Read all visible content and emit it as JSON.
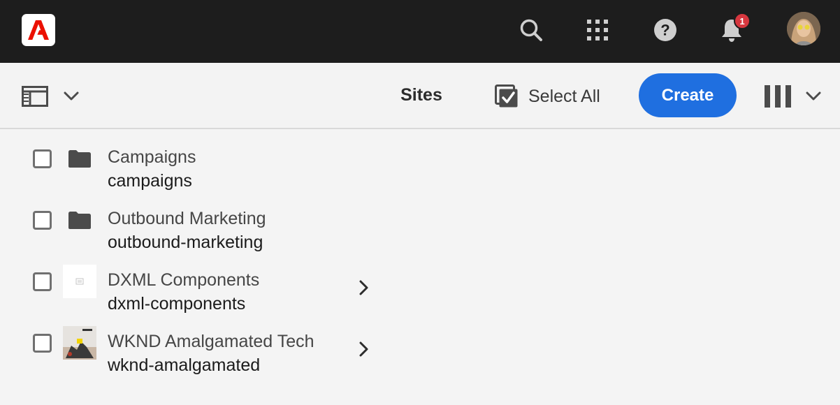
{
  "shell": {
    "logo_icon": "adobe-logo-icon",
    "notification_count": "1",
    "icons": [
      "search-icon",
      "apps-grid-icon",
      "help-icon",
      "bell-icon",
      "avatar"
    ],
    "colors": {
      "bar": "#1d1d1d",
      "logo_red": "#eb1000",
      "badge": "#d7373f"
    }
  },
  "actionbar": {
    "title": "Sites",
    "select_all_label": "Select All",
    "create_label": "Create",
    "colors": {
      "create": "#1f6fe0"
    }
  },
  "items": [
    {
      "name": "Campaigns",
      "slug": "campaigns",
      "type": "folder",
      "has_children": false
    },
    {
      "name": "Outbound Marketing",
      "slug": "outbound-marketing",
      "type": "folder",
      "has_children": false
    },
    {
      "name": "DXML Components",
      "slug": "dxml-components",
      "type": "page",
      "has_children": true
    },
    {
      "name": "WKND Amalgamated Tech",
      "slug": "wknd-amalgamated",
      "type": "image",
      "has_children": true
    }
  ]
}
